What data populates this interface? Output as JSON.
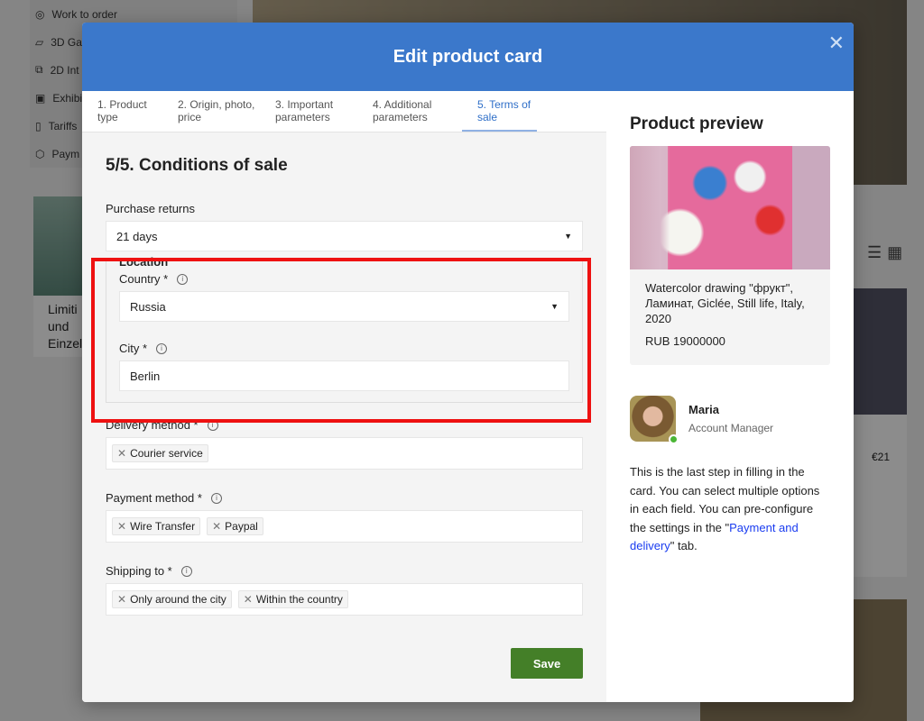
{
  "background": {
    "sidebar": [
      {
        "label": "Work to order",
        "icon": "target-icon"
      },
      {
        "label": "3D Ga",
        "icon": "map-icon"
      },
      {
        "label": "2D Int",
        "icon": "devices-icon"
      },
      {
        "label": "Exhibi",
        "icon": "image-icon"
      },
      {
        "label": "Tariffs",
        "icon": "file-icon"
      },
      {
        "label": "Paym",
        "icon": "box-icon"
      }
    ],
    "card_text": "Limiti und Einzel",
    "card_price": "€21"
  },
  "modal": {
    "title": "Edit product card",
    "close_icon": "close-icon",
    "tabs": [
      {
        "label": "1. Product type"
      },
      {
        "label": "2. Origin, photo, price"
      },
      {
        "label": "3. Important parameters"
      },
      {
        "label": "4. Additional parameters"
      },
      {
        "label": "5. Terms of sale",
        "active": true
      }
    ],
    "section_title": "5/5. Conditions of sale",
    "purchase_returns": {
      "label": "Purchase returns",
      "value": "21 days"
    },
    "location": {
      "legend": "Location",
      "country": {
        "label": "Country *",
        "value": "Russia"
      },
      "city": {
        "label": "City *",
        "value": "Berlin"
      }
    },
    "delivery": {
      "label": "Delivery method *",
      "tags": [
        "Courier service"
      ]
    },
    "payment": {
      "label": "Payment method *",
      "tags": [
        "Wire Transfer",
        "Paypal"
      ]
    },
    "shipping": {
      "label": "Shipping to *",
      "tags": [
        "Only around the city",
        "Within the country"
      ]
    },
    "save_label": "Save",
    "save_color": "#447f28",
    "accent": "#3b78cb",
    "preview": {
      "title": "Product preview",
      "description": "Watercolor drawing \"фрукт\", Ламинат, Giclée, Still life, Italy, 2020",
      "price": "RUB 19000000"
    },
    "manager": {
      "name": "Maria",
      "role": "Account Manager",
      "status": "online"
    },
    "help": {
      "before": "This is the last step in filling in the card. You can select multiple options in each field. You can pre-configure the settings in the ",
      "q1": "\"",
      "link": "Payment and delivery",
      "after": "\" tab."
    }
  }
}
